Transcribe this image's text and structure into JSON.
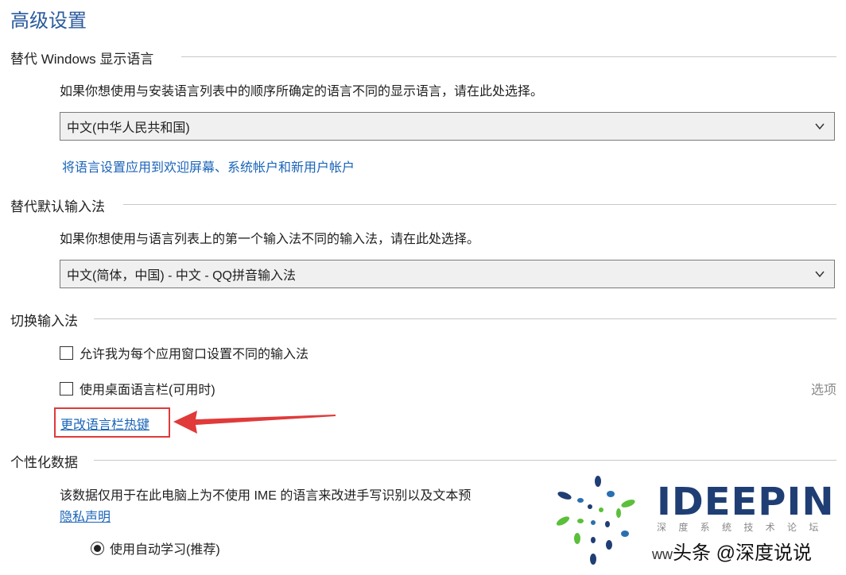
{
  "page_title": "高级设置",
  "display_language": {
    "heading": "替代 Windows 显示语言",
    "description": "如果你想使用与安装语言列表中的顺序所确定的语言不同的显示语言，请在此处选择。",
    "selected": "中文(中华人民共和国)",
    "apply_link": "将语言设置应用到欢迎屏幕、系统帐户和新用户帐户"
  },
  "input_method": {
    "heading": "替代默认输入法",
    "description": "如果你想使用与语言列表上的第一个输入法不同的输入法，请在此处选择。",
    "selected": "中文(简体，中国) - 中文 - QQ拼音输入法"
  },
  "switch_input": {
    "heading": "切换输入法",
    "checkbox_per_app": "允许我为每个应用窗口设置不同的输入法",
    "checkbox_language_bar": "使用桌面语言栏(可用时)",
    "options_label": "选项",
    "hotkey_link": "更改语言栏热键"
  },
  "personalization": {
    "heading": "个性化数据",
    "description": "该数据仅用于在此电脑上为不使用 IME 的语言来改进手写识别以及文本预",
    "privacy_link": "隐私声明",
    "radio_auto_learn": "使用自动学习(推荐)"
  },
  "branding": {
    "logo_text": "IDEEPIN",
    "logo_subtext": "深 度 系 统 技 术 论 坛",
    "watermark": "头条 @深度说说",
    "watermark_prefix": "ww"
  },
  "colors": {
    "accent_link": "#1a64b8",
    "title": "#2a5a9e",
    "annotation_red": "#e03a3a",
    "logo_navy": "#1f3e74",
    "logo_green": "#5bbf3a"
  },
  "icons": {
    "dropdown": "chevron-down-icon",
    "annotation": "red-arrow-icon",
    "logo": "spiral-dots-logo-icon"
  }
}
